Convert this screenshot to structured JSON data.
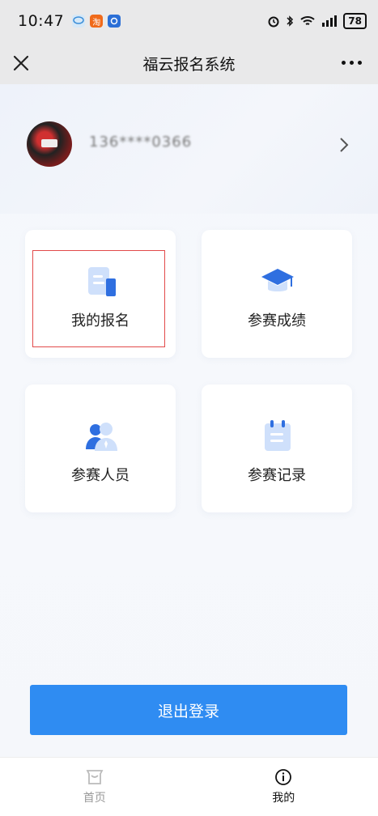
{
  "status_bar": {
    "time": "10:47",
    "battery": "78",
    "apps": [
      {
        "icon": "chat-bubble-icon",
        "color": "#3a8dd8"
      },
      {
        "icon": "taobao-icon",
        "text": "淘",
        "color": "#f06a1a"
      },
      {
        "icon": "app-blue-icon",
        "color": "#2b6fd6"
      }
    ]
  },
  "nav": {
    "title": "福云报名系统"
  },
  "profile": {
    "phone": "136****0366"
  },
  "menu": [
    {
      "label": "我的报名",
      "icon": "document-icon"
    },
    {
      "label": "参赛成绩",
      "icon": "graduation-cap-icon"
    },
    {
      "label": "参赛人员",
      "icon": "people-icon"
    },
    {
      "label": "参赛记录",
      "icon": "calendar-note-icon"
    }
  ],
  "logout_label": "退出登录",
  "tabs": [
    {
      "label": "首页",
      "icon": "home-icon",
      "active": false
    },
    {
      "label": "我的",
      "icon": "profile-info-icon",
      "active": true
    }
  ],
  "colors": {
    "accent": "#2f8cf2",
    "highlight": "#e24a4a"
  }
}
